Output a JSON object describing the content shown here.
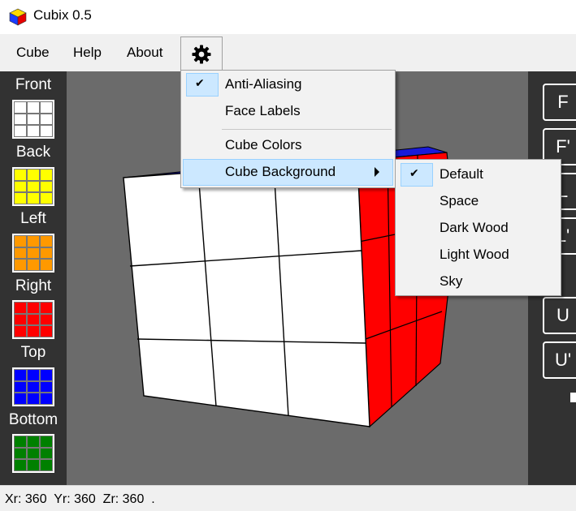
{
  "window": {
    "title": "Cubix 0.5"
  },
  "menubar": {
    "items": [
      "Cube",
      "Help",
      "About"
    ]
  },
  "palette": {
    "faces": [
      {
        "label": "Front",
        "color": "#ffffff"
      },
      {
        "label": "Back",
        "color": "#ffff00"
      },
      {
        "label": "Left",
        "color": "#ff9900"
      },
      {
        "label": "Right",
        "color": "#ff0000"
      },
      {
        "label": "Top",
        "color": "#0000ff"
      },
      {
        "label": "Bottom",
        "color": "#008000"
      }
    ]
  },
  "right_panel": {
    "buttons": [
      "F",
      "F'",
      "L",
      "L'",
      "U",
      "U'"
    ]
  },
  "settings_menu": {
    "items": [
      {
        "label": "Anti-Aliasing",
        "checked": true
      },
      {
        "label": "Face Labels",
        "checked": false
      },
      {
        "label": "Cube Colors",
        "checked": false
      },
      {
        "label": "Cube Background",
        "checked": false,
        "has_submenu": true
      }
    ]
  },
  "background_submenu": {
    "items": [
      {
        "label": "Default",
        "checked": true
      },
      {
        "label": "Space",
        "checked": false
      },
      {
        "label": "Dark Wood",
        "checked": false
      },
      {
        "label": "Light Wood",
        "checked": false
      },
      {
        "label": "Sky",
        "checked": false
      }
    ]
  },
  "status": {
    "text": "Xr: 360  Yr: 360  Zr: 360  ."
  },
  "colors": {
    "viewport_bg": "#6b6b6b",
    "panel_bg": "#323232",
    "highlight": "#cce8ff"
  }
}
